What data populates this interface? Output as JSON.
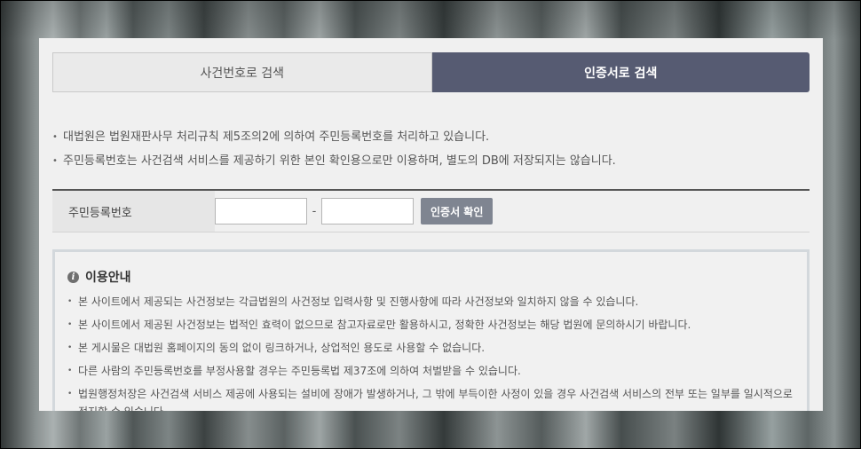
{
  "tabs": [
    {
      "label": "사건번호로 검색",
      "active": false
    },
    {
      "label": "인증서로 검색",
      "active": true
    }
  ],
  "notices": [
    "대법원은 법원재판사무 처리규칙 제5조의2에 의하여 주민등록번호를 처리하고 있습니다.",
    "주민등록번호는 사건검색 서비스를 제공하기 위한 본인 확인용으로만 이용하며, 별도의 DB에 저장되지는 않습니다."
  ],
  "form": {
    "label": "주민등록번호",
    "first_value": "",
    "second_value": "",
    "separator": "-",
    "button_label": "인증서 확인"
  },
  "info": {
    "title": "이용안내",
    "icon": "info-icon",
    "items": [
      "본 사이트에서 제공되는 사건정보는 각급법원의 사건정보 입력사항 및 진행사항에 따라 사건정보와 일치하지 않을 수 있습니다.",
      "본 사이트에서 제공된 사건정보는 법적인 효력이 없으므로 참고자료로만 활용하시고, 정확한 사건정보는 해당 법원에 문의하시기 바랍니다.",
      "본 게시물은 대법원 홈페이지의 동의 없이 링크하거나, 상업적인 용도로 사용할 수 없습니다.",
      "다른 사람의 주민등록번호를 부정사용할 경우는 주민등록법 제37조에 의하여 처벌받을 수 있습니다.",
      "법원행정처장은 사건검색 서비스 제공에 사용되는 설비에 장애가 발생하거나, 그 밖에 부득이한 사정이 있을 경우 사건검색 서비스의 전부 또는 일부를 일시적으로 정지할 수 있습니다."
    ]
  },
  "colors": {
    "active_tab": "#565b72",
    "button": "#7f8591",
    "panel": "#f0f0f0"
  }
}
